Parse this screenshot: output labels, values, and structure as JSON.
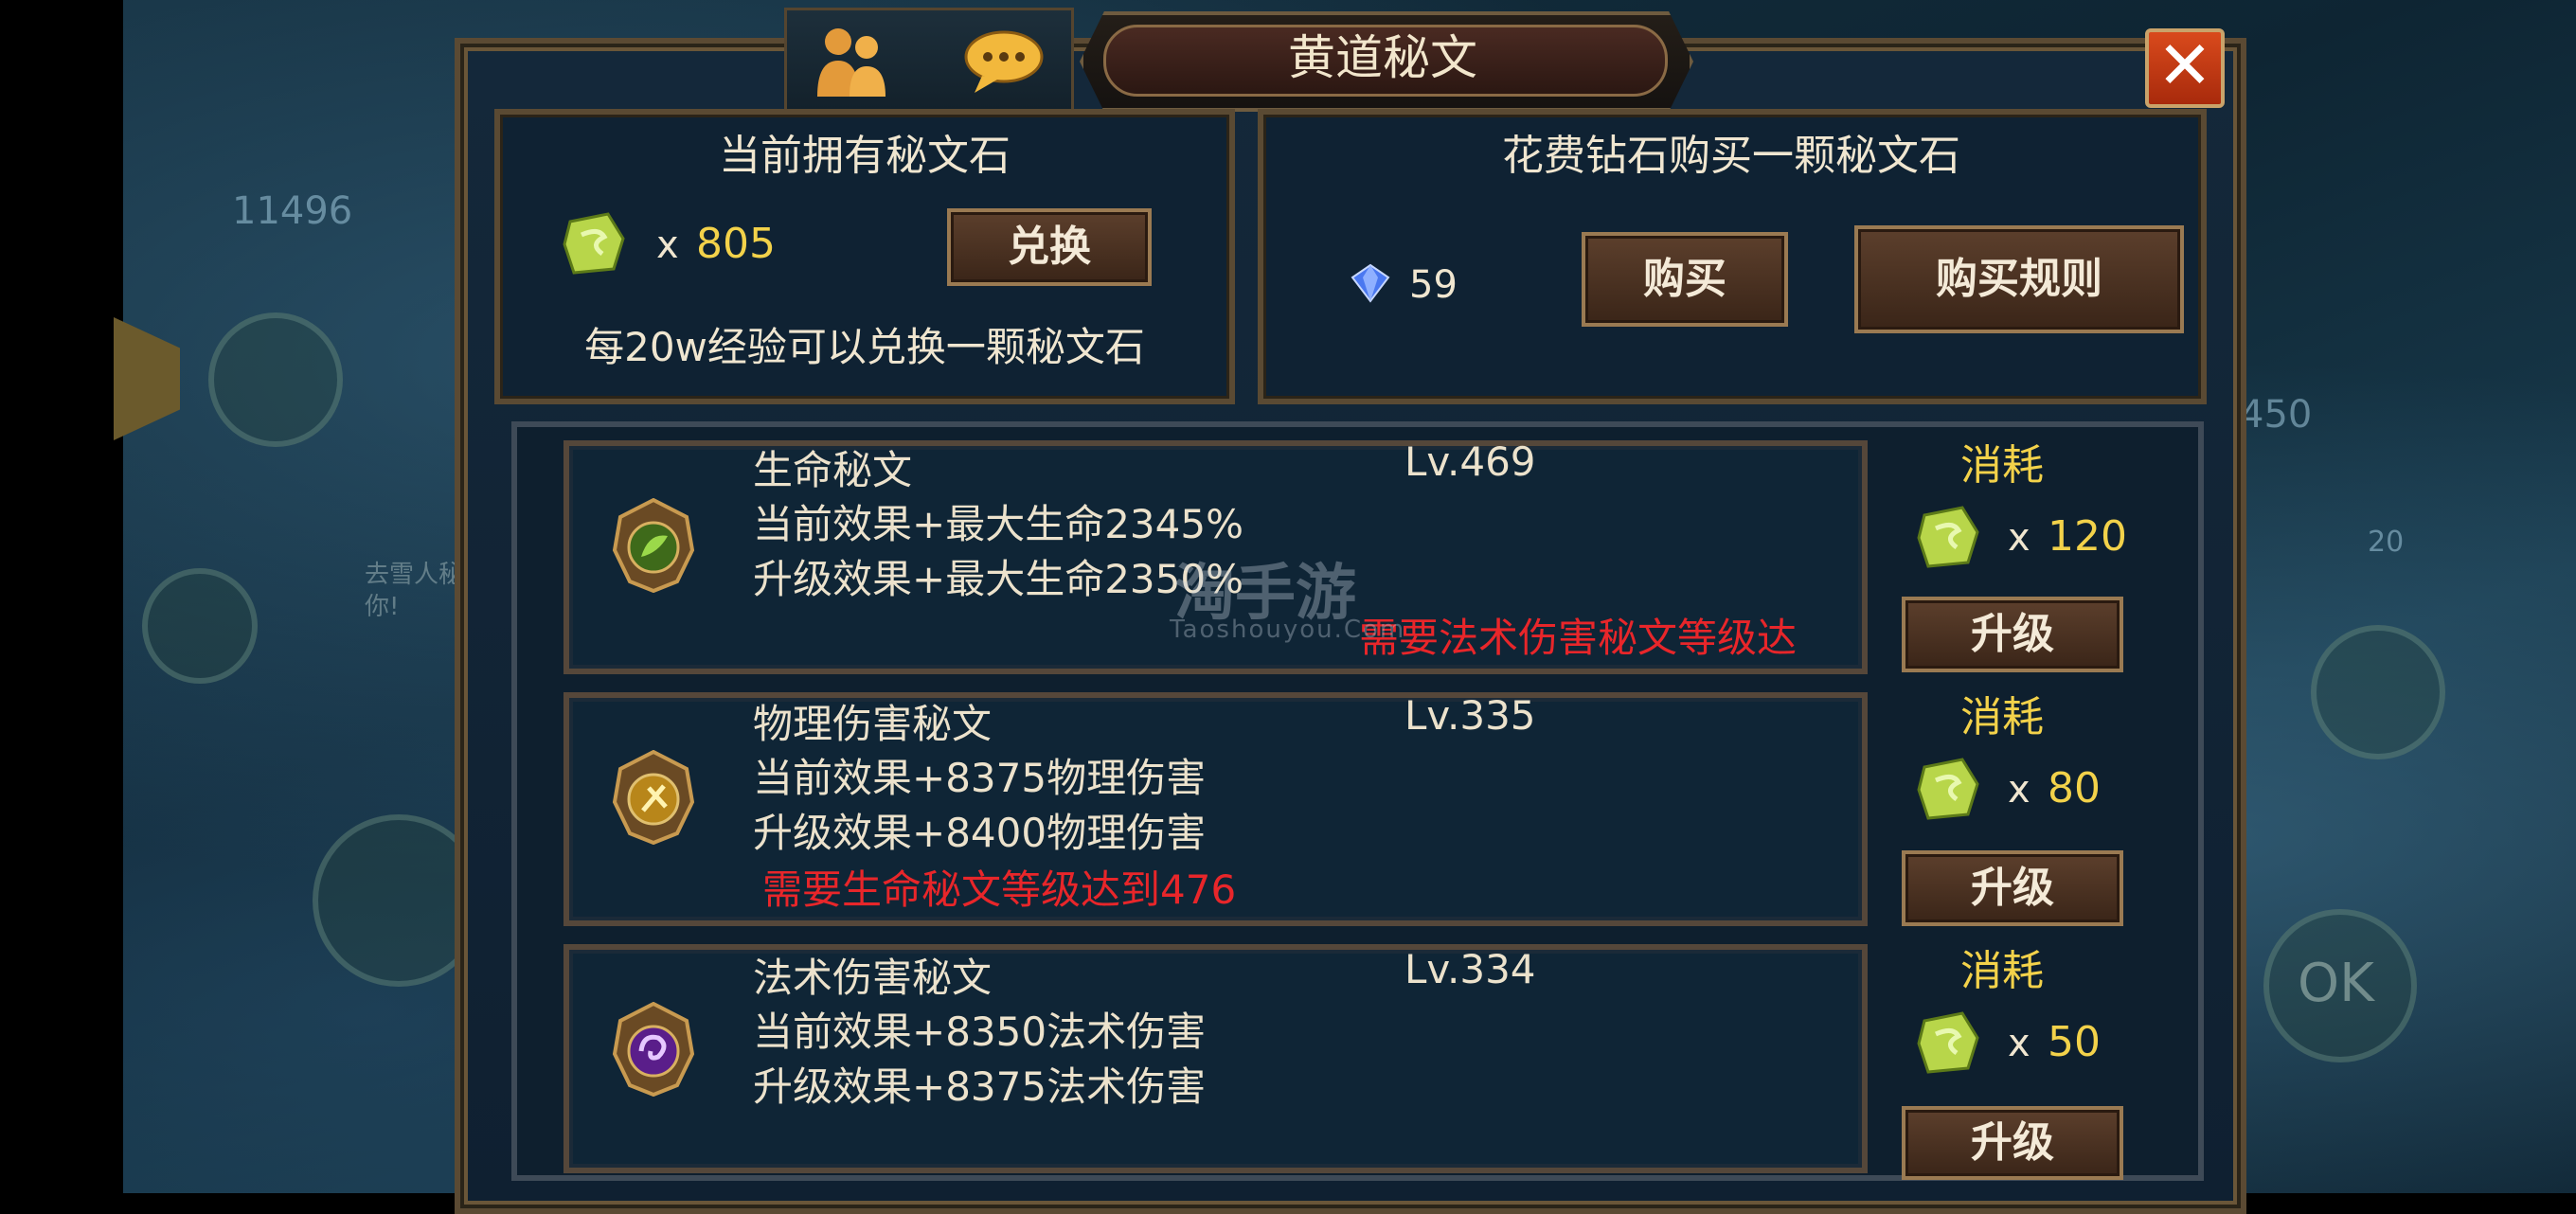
{
  "background": {
    "left_number": "11496",
    "right_number": "450",
    "small_number": "20",
    "hint_text": "去雪人秘文理财诉你!",
    "ok_label": "OK"
  },
  "dialog": {
    "title": "黄道秘文"
  },
  "owned": {
    "heading": "当前拥有秘文石",
    "x": "x",
    "count": "805",
    "exchange_label": "兑换",
    "note": "每20w经验可以兑换一颗秘文石"
  },
  "purchase": {
    "heading": "花费钻石购买一颗秘文石",
    "diamond_count": "59",
    "buy_label": "购买",
    "rules_label": "购买规则"
  },
  "runes": [
    {
      "name": "生命秘文",
      "level": "Lv.469",
      "current": "当前效果+最大生命2345%",
      "next": "升级效果+最大生命2350%",
      "requirement": "需要法术伤害秘文等级达",
      "cost_label": "消耗",
      "x": "x",
      "cost": "120",
      "upgrade_label": "升级"
    },
    {
      "name": "物理伤害秘文",
      "level": "Lv.335",
      "current": "当前效果+8375物理伤害",
      "next": "升级效果+8400物理伤害",
      "requirement": "需要生命秘文等级达到476",
      "cost_label": "消耗",
      "x": "x",
      "cost": "80",
      "upgrade_label": "升级"
    },
    {
      "name": "法术伤害秘文",
      "level": "Lv.334",
      "current": "当前效果+8350法术伤害",
      "next": "升级效果+8375法术伤害",
      "cost_label": "消耗",
      "x": "x",
      "cost": "50",
      "upgrade_label": "升级"
    }
  ],
  "watermark": {
    "main": "淘手游",
    "sub": "Taoshouyou.Com"
  },
  "icons": {
    "friends": "friends-icon",
    "chat": "chat-icon",
    "close": "close-icon",
    "stone": "runestone-icon",
    "diamond": "diamond-icon",
    "life_rune": "life-rune-icon",
    "physical_rune": "physical-rune-icon",
    "magic_rune": "magic-rune-icon"
  },
  "colors": {
    "accent_yellow": "#f3d24a",
    "requirement_red": "#e8262a",
    "close_orange": "#d94a1c"
  }
}
